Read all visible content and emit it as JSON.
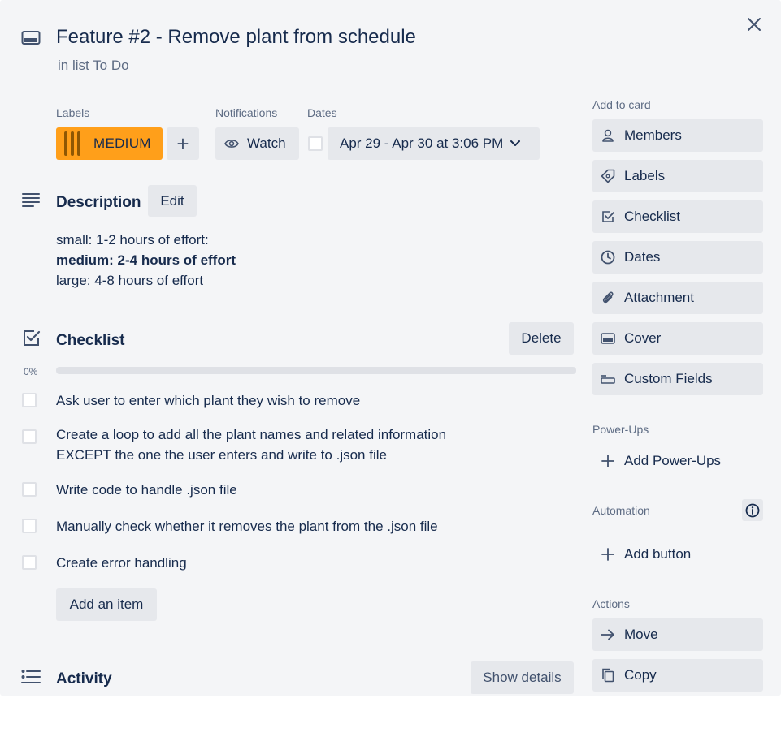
{
  "card": {
    "title": "Feature #2 - Remove plant from schedule",
    "in_list_prefix": "in list",
    "list_name": "To Do",
    "icon": "card-icon"
  },
  "labels": {
    "heading": "Labels",
    "items": [
      {
        "name": "MEDIUM",
        "color": "#ff9f1a"
      }
    ],
    "add_symbol": "+"
  },
  "notifications": {
    "heading": "Notifications",
    "watch_label": "Watch"
  },
  "dates": {
    "heading": "Dates",
    "value": "Apr 29 - Apr 30 at 3:06 PM",
    "checked": false
  },
  "description": {
    "heading": "Description",
    "edit_label": "Edit",
    "lines": [
      "small: 1-2 hours of effort:",
      "medium: 2-4 hours of effort",
      "large: 4-8 hours of effort"
    ]
  },
  "checklist": {
    "heading": "Checklist",
    "delete_label": "Delete",
    "progress_text": "0%",
    "progress": 0,
    "items": [
      {
        "text": "Ask user to enter which plant they wish to remove",
        "checked": false
      },
      {
        "text": "Create a loop to add all the plant names and related information",
        "text2": "EXCEPT the one the user enters and write to .json file",
        "checked": false
      },
      {
        "text": "Write code to handle .json file",
        "checked": false
      },
      {
        "text": "Manually check whether it removes the plant from the .json file",
        "checked": false
      },
      {
        "text": "Create error handling",
        "checked": false
      }
    ],
    "add_item_label": "Add an item"
  },
  "activity": {
    "heading": "Activity",
    "show_details_label": "Show details"
  },
  "sidebar": {
    "add_to_card_heading": "Add to card",
    "add_to_card": [
      {
        "label": "Members",
        "icon": "person-icon"
      },
      {
        "label": "Labels",
        "icon": "tag-icon"
      },
      {
        "label": "Checklist",
        "icon": "checklist-icon"
      },
      {
        "label": "Dates",
        "icon": "clock-icon"
      },
      {
        "label": "Attachment",
        "icon": "paperclip-icon"
      },
      {
        "label": "Cover",
        "icon": "cover-icon"
      },
      {
        "label": "Custom Fields",
        "icon": "custom-fields-icon"
      }
    ],
    "powerups_heading": "Power-Ups",
    "add_powerups_label": "Add Power-Ups",
    "automation_heading": "Automation",
    "add_button_label": "Add button",
    "actions_heading": "Actions",
    "actions": [
      {
        "label": "Move",
        "icon": "arrow-right-icon"
      },
      {
        "label": "Copy",
        "icon": "copy-icon"
      }
    ]
  },
  "colors": {
    "background": "#f4f5f7",
    "button": "#e6e8ec",
    "text": "#172b4d",
    "muted": "#5e6c84",
    "label_orange": "#ff9f1a"
  }
}
